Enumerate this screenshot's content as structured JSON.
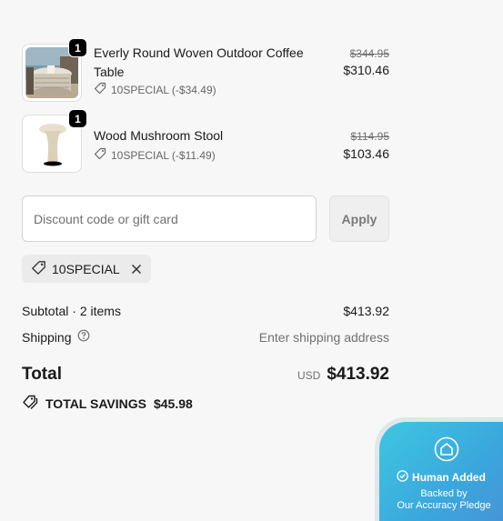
{
  "items": [
    {
      "quantity": "1",
      "title": "Everly Round Woven Outdoor Coffee Table",
      "discount_label": "10SPECIAL (-$34.49)",
      "original_price": "$344.95",
      "price": "$310.46"
    },
    {
      "quantity": "1",
      "title": "Wood Mushroom Stool",
      "discount_label": "10SPECIAL (-$11.49)",
      "original_price": "$114.95",
      "price": "$103.46"
    }
  ],
  "discount": {
    "placeholder": "Discount code or gift card",
    "apply_label": "Apply",
    "applied_code": "10SPECIAL"
  },
  "summary": {
    "subtotal_label": "Subtotal · 2 items",
    "subtotal_value": "$413.92",
    "shipping_label": "Shipping",
    "shipping_value": "Enter shipping address",
    "total_label": "Total",
    "currency": "USD",
    "total_value": "$413.92",
    "savings_label": "TOTAL SAVINGS",
    "savings_value": "$45.98"
  },
  "badge": {
    "title": "Human Added",
    "line1": "Backed by",
    "line2": "Our Accuracy Pledge"
  },
  "colors": {
    "badge_gradient_start": "#3fc6e2",
    "badge_gradient_end": "#4a8ed6"
  }
}
